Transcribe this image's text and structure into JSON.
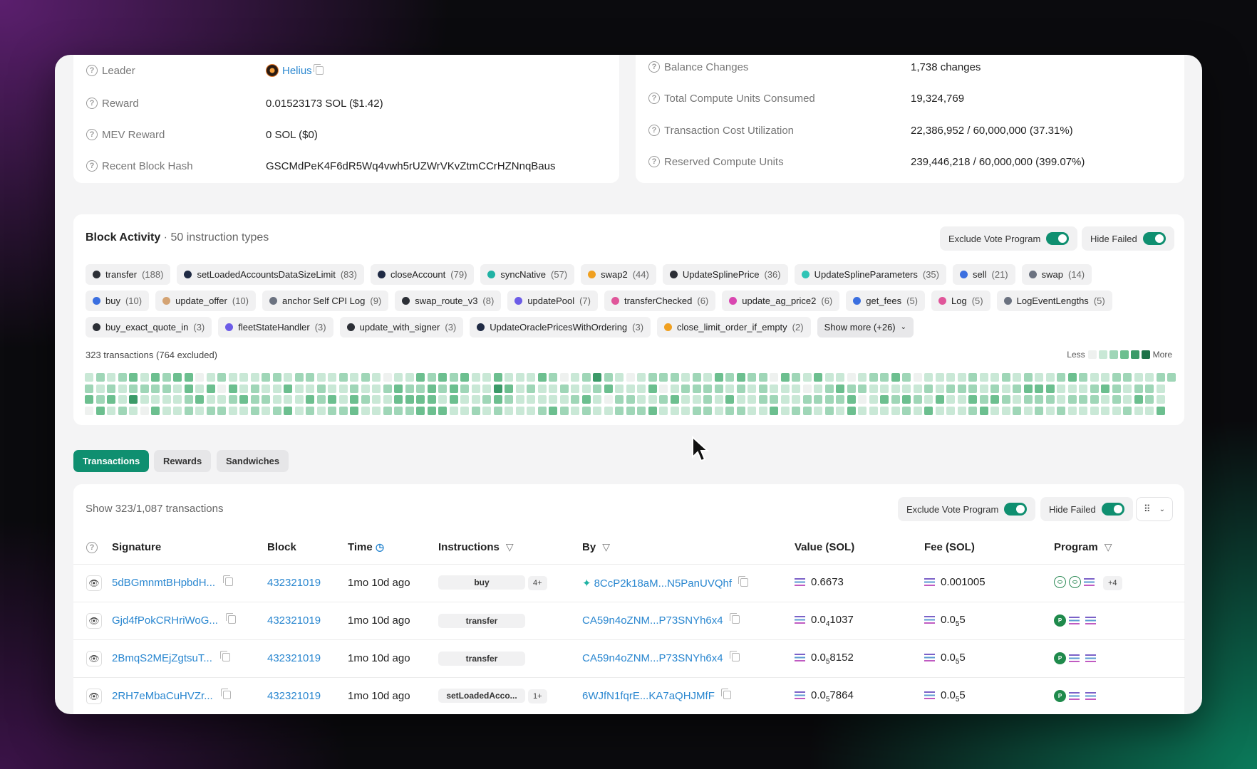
{
  "block_info": {
    "left": [
      {
        "label": "Leader",
        "value": "Helius"
      },
      {
        "label": "Reward",
        "value": "0.01523173 SOL ($1.42)"
      },
      {
        "label": "MEV Reward",
        "value": "0 SOL ($0)"
      },
      {
        "label": "Recent Block Hash",
        "value": "GSCMdPeK4F6dR5Wq4vwh5rUZWrVKvZtmCCrHZNnqBaus"
      }
    ],
    "right": [
      {
        "label": "Balance Changes",
        "value": "1,738 changes"
      },
      {
        "label": "Total Compute Units Consumed",
        "value": "19,324,769"
      },
      {
        "label": "Transaction Cost Utilization",
        "value": "22,386,952 / 60,000,000 (37.31%)"
      },
      {
        "label": "Reserved Compute Units",
        "value": "239,446,218 / 60,000,000 (399.07%)"
      }
    ]
  },
  "activity": {
    "title": "Block Activity",
    "subtitle": "· 50 instruction types",
    "exclude_vote_label": "Exclude Vote Program",
    "hide_failed_label": "Hide Failed",
    "chips": [
      {
        "name": "transfer",
        "count": "(188)",
        "color": "#2c2f36"
      },
      {
        "name": "setLoadedAccountsDataSizeLimit",
        "count": "(83)",
        "color": "#1f2a44"
      },
      {
        "name": "closeAccount",
        "count": "(79)",
        "color": "#1f2a44"
      },
      {
        "name": "syncNative",
        "count": "(57)",
        "color": "#20b2a4"
      },
      {
        "name": "swap2",
        "count": "(44)",
        "color": "#f0a020"
      },
      {
        "name": "UpdateSplinePrice",
        "count": "(36)",
        "color": "#2c2f36"
      },
      {
        "name": "UpdateSplineParameters",
        "count": "(35)",
        "color": "#2ec4b6"
      },
      {
        "name": "sell",
        "count": "(21)",
        "color": "#3b6fe0"
      },
      {
        "name": "swap",
        "count": "(14)",
        "color": "#6b7280"
      },
      {
        "name": "buy",
        "count": "(10)",
        "color": "#3b6fe0"
      },
      {
        "name": "update_offer",
        "count": "(10)",
        "color": "#d4a373"
      },
      {
        "name": "anchor Self CPI Log",
        "count": "(9)",
        "color": "#6b7280"
      },
      {
        "name": "swap_route_v3",
        "count": "(8)",
        "color": "#2c2f36"
      },
      {
        "name": "updatePool",
        "count": "(7)",
        "color": "#6c5ce7"
      },
      {
        "name": "transferChecked",
        "count": "(6)",
        "color": "#e0569a"
      },
      {
        "name": "update_ag_price2",
        "count": "(6)",
        "color": "#d946b0"
      },
      {
        "name": "get_fees",
        "count": "(5)",
        "color": "#3b6fe0"
      },
      {
        "name": "Log",
        "count": "(5)",
        "color": "#e0569a"
      },
      {
        "name": "LogEventLengths",
        "count": "(5)",
        "color": "#6b7280"
      },
      {
        "name": "buy_exact_quote_in",
        "count": "(3)",
        "color": "#2c2f36"
      },
      {
        "name": "fleetStateHandler",
        "count": "(3)",
        "color": "#6c5ce7"
      },
      {
        "name": "update_with_signer",
        "count": "(3)",
        "color": "#2c2f36"
      },
      {
        "name": "UpdateOraclePricesWithOrdering",
        "count": "(3)",
        "color": "#1f2a44"
      },
      {
        "name": "close_limit_order_if_empty",
        "count": "(2)",
        "color": "#f0a020"
      }
    ],
    "show_more": "Show more (+26)",
    "tx_count_label": "323 transactions (764 excluded)",
    "legend_less": "Less",
    "legend_more": "More",
    "legend_colors": [
      "#eef1ef",
      "#c9e8d6",
      "#9fd6b7",
      "#6cbf8f",
      "#3b9a68",
      "#1d7148"
    ],
    "heat_levels": [
      1,
      2,
      3,
      0,
      2,
      1,
      2,
      3,
      1,
      2,
      3,
      1,
      2,
      1,
      1,
      2,
      3,
      2,
      4,
      1,
      1,
      2,
      1,
      0,
      3,
      2,
      1,
      3,
      2,
      2,
      1,
      1,
      3,
      1,
      1,
      1,
      3,
      3,
      2,
      2,
      0,
      1,
      3,
      1,
      1,
      3,
      1,
      2,
      2,
      0,
      1,
      2,
      1,
      3,
      2,
      1,
      1,
      1,
      3,
      1,
      1,
      2,
      2,
      2,
      2,
      1,
      2,
      1,
      2,
      1,
      1,
      2,
      1,
      3,
      1,
      3,
      2,
      1,
      1,
      1,
      2,
      1,
      3,
      2,
      1,
      2,
      2,
      1,
      1,
      1,
      3,
      2,
      2,
      1,
      1,
      2,
      1,
      2,
      3,
      3,
      2,
      1,
      2,
      1,
      1,
      1,
      1,
      1,
      0,
      2,
      1,
      2,
      1,
      3,
      3,
      2,
      1,
      2,
      3,
      2,
      3,
      2,
      3,
      3,
      2,
      3,
      3,
      3,
      3,
      2,
      1,
      3,
      2,
      3,
      3,
      1,
      3,
      2,
      1,
      1,
      1,
      1,
      1,
      2,
      1,
      1,
      2,
      1,
      3,
      4,
      3,
      2,
      1,
      3,
      2,
      1,
      1,
      1,
      1,
      1,
      1,
      2,
      1,
      1,
      3,
      1,
      1,
      2,
      2,
      1,
      1,
      3,
      0,
      2,
      1,
      2,
      1,
      1,
      2,
      1,
      2,
      1,
      3,
      2,
      4,
      2,
      1,
      1,
      2,
      3,
      0,
      1,
      1,
      1,
      2,
      2,
      0,
      1,
      2,
      2,
      1,
      1,
      1,
      2,
      2,
      3,
      1,
      3,
      2,
      0,
      2,
      1,
      2,
      1,
      3,
      1,
      1,
      2,
      1,
      1,
      2,
      2,
      1,
      2,
      1,
      2,
      2,
      2,
      3,
      2,
      1,
      1,
      2,
      1,
      3,
      2,
      3,
      2,
      1,
      2,
      2,
      1,
      1,
      1,
      2,
      2,
      2,
      1,
      0,
      1,
      2,
      3,
      3,
      1,
      1,
      1,
      2,
      1,
      1,
      2,
      1,
      0,
      2,
      2,
      3,
      1,
      2,
      1,
      1,
      2,
      2,
      2,
      1,
      3,
      2,
      1,
      0,
      2,
      3,
      3,
      1,
      2,
      0,
      1,
      2,
      1,
      1,
      1,
      2,
      1,
      3,
      1,
      3,
      1,
      2,
      1,
      2,
      1,
      3,
      2,
      0,
      1,
      2,
      1,
      1,
      2,
      1,
      3,
      1,
      1,
      3,
      1,
      1,
      2,
      1,
      1,
      1,
      2,
      1,
      1,
      2,
      2,
      3,
      2,
      1,
      1,
      2,
      3,
      1,
      2,
      3,
      1,
      2,
      1,
      2,
      1,
      1,
      2,
      1,
      2,
      2,
      3,
      2,
      1,
      1,
      3,
      2,
      2,
      1,
      3,
      2,
      1,
      2,
      1,
      1,
      2,
      3,
      1,
      2,
      1,
      2,
      1,
      2,
      1,
      1,
      2,
      2,
      1,
      1,
      3,
      1,
      1,
      2,
      2,
      2,
      1,
      2,
      1,
      1,
      2,
      1,
      2,
      3,
      1,
      1,
      2,
      2,
      1,
      2,
      1,
      1,
      3,
      2
    ]
  },
  "tabs": [
    "Transactions",
    "Rewards",
    "Sandwiches"
  ],
  "transactions": {
    "show_label": "Show 323/1,087 transactions",
    "exclude_vote_label": "Exclude Vote Program",
    "hide_failed_label": "Hide Failed",
    "columns": {
      "signature": "Signature",
      "block": "Block",
      "time": "Time",
      "instructions": "Instructions",
      "by": "By",
      "value": "Value (SOL)",
      "fee": "Fee (SOL)",
      "program": "Program"
    },
    "rows": [
      {
        "signature": "5dBGmnmtBHpbdH...",
        "block": "432321019",
        "time": "1mo 10d ago",
        "instr": "buy",
        "instr_more": "4+",
        "by": "8CcP2k18aM...N5PanUVQhf",
        "value_main": "0.6673",
        "value_sub": "",
        "value_rest": "",
        "fee_main": "0.001005",
        "fee_sub": "",
        "fee_rest": "",
        "programs_more": "+4"
      },
      {
        "signature": "Gjd4fPokCRHriWoG...",
        "block": "432321019",
        "time": "1mo 10d ago",
        "instr": "transfer",
        "instr_more": "",
        "by": "CA59n4oZNM...P73SNYh6x4",
        "value_main": "0.0",
        "value_sub": "4",
        "value_rest": "1037",
        "fee_main": "0.0",
        "fee_sub": "5",
        "fee_rest": "5",
        "programs_more": ""
      },
      {
        "signature": "2BmqS2MEjZgtsuT...",
        "block": "432321019",
        "time": "1mo 10d ago",
        "instr": "transfer",
        "instr_more": "",
        "by": "CA59n4oZNM...P73SNYh6x4",
        "value_main": "0.0",
        "value_sub": "5",
        "value_rest": "8152",
        "fee_main": "0.0",
        "fee_sub": "5",
        "fee_rest": "5",
        "programs_more": ""
      },
      {
        "signature": "2RH7eMbaCuHVZr...",
        "block": "432321019",
        "time": "1mo 10d ago",
        "instr": "setLoadedAcco...",
        "instr_more": "1+",
        "by": "6WJfN1fqrE...KA7aQHJMfF",
        "value_main": "0.0",
        "value_sub": "5",
        "value_rest": "7864",
        "fee_main": "0.0",
        "fee_sub": "5",
        "fee_rest": "5",
        "programs_more": ""
      }
    ]
  }
}
